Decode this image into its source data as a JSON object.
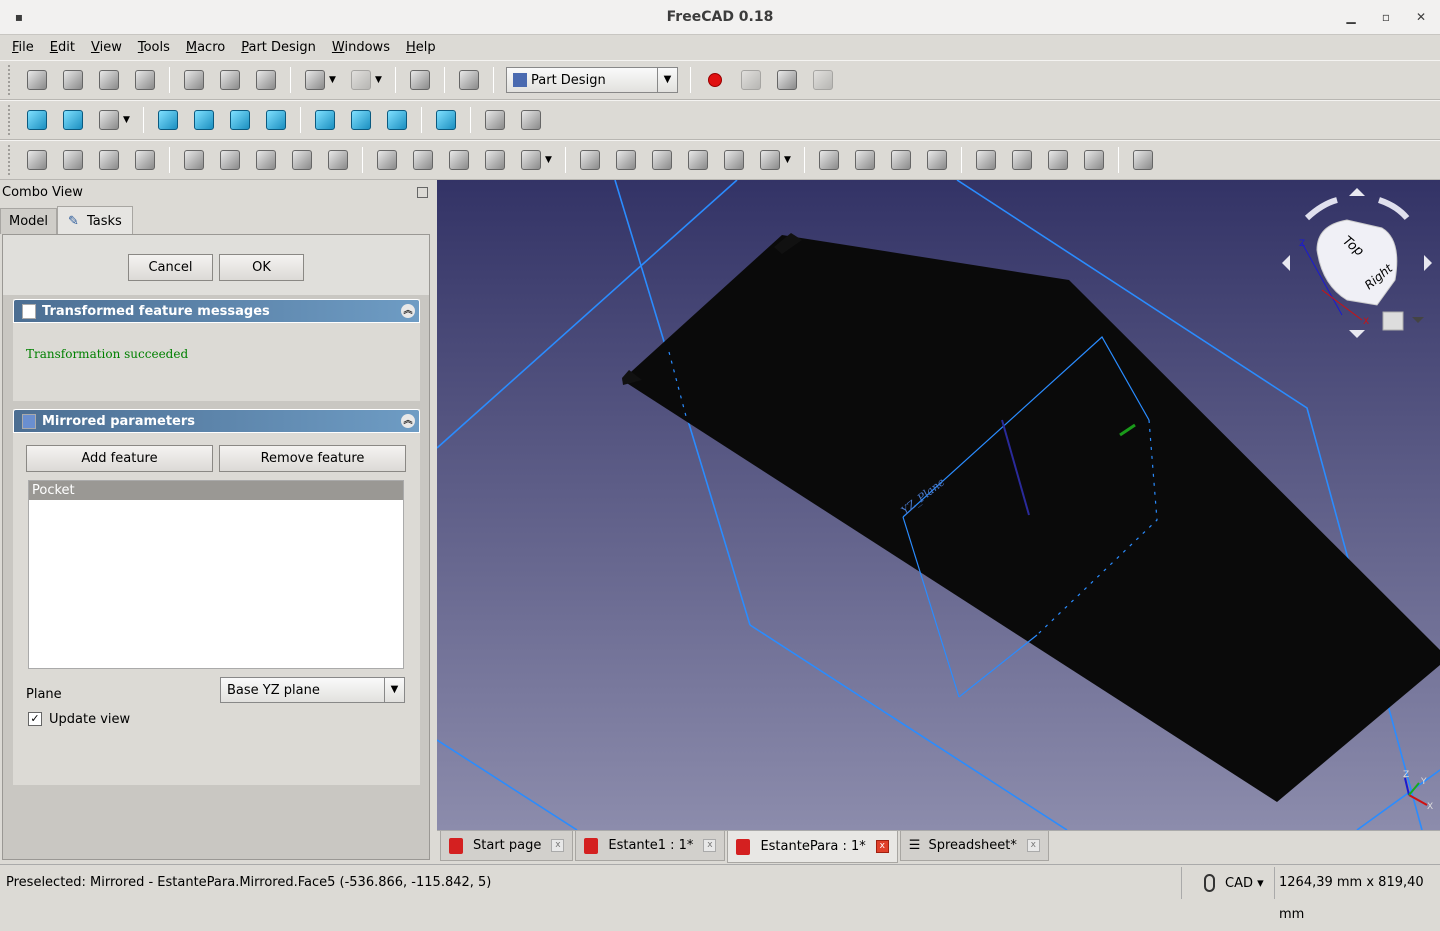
{
  "window": {
    "title": "FreeCAD 0.18",
    "min": "▁",
    "max": "▫",
    "close": "✕",
    "app_icon": "▪"
  },
  "menu": [
    "File",
    "Edit",
    "View",
    "Tools",
    "Macro",
    "Part Design",
    "Windows",
    "Help"
  ],
  "toolbar1": {
    "icons": [
      "new-file",
      "open-file",
      "import",
      "print",
      "|",
      "cut",
      "copy",
      "paste",
      "|",
      "undo",
      "undo-dropdown",
      "redo",
      "redo-dropdown",
      "|",
      "refresh",
      "|",
      "whats-this",
      "|",
      "WB",
      "|",
      "record-macro",
      "stop-macro",
      "edit-macro",
      "run-macro"
    ],
    "workbench": "Part Design"
  },
  "toolbar2": {
    "icons": [
      "fit-all",
      "fit-selection",
      "draw-style",
      "draw-style-dropdown",
      "|",
      "isometric-view",
      "front-view",
      "top-view",
      "right-view",
      "|",
      "rear-view",
      "bottom-view",
      "left-view",
      "|",
      "measure-distance",
      "|",
      "part-icon",
      "group-icon"
    ]
  },
  "toolbar3": {
    "icons": [
      "create-body",
      "create-part",
      "shape-binder",
      "clone",
      "|",
      "datum-point",
      "datum-line",
      "datum-plane",
      "datum-shape",
      "sketch",
      "|",
      "pad",
      "revolution",
      "additive-loft",
      "additive-pipe",
      "additive-primitive",
      "additive-dropdown",
      "|",
      "pocket",
      "hole",
      "groove",
      "subtractive-loft",
      "subtractive-pipe",
      "subtractive-primitive",
      "subtractive-dropdown",
      "|",
      "mirrored",
      "linear-pattern",
      "polar-pattern",
      "multi-transform",
      "|",
      "fillet",
      "chamfer",
      "draft",
      "thickness",
      "|",
      "boolean"
    ]
  },
  "combo": {
    "title": "Combo View",
    "tabs": [
      "Model",
      "Tasks"
    ]
  },
  "task": {
    "cancel": "Cancel",
    "ok": "OK",
    "messages": {
      "title": "Transformed feature messages",
      "text": "Transformation succeeded",
      "text_color": "#008000"
    },
    "mirrored": {
      "title": "Mirrored parameters",
      "add": "Add feature",
      "remove": "Remove feature",
      "features": [
        "Pocket"
      ],
      "plane_label": "Plane",
      "plane_value": "Base YZ plane",
      "update_label": "Update view",
      "update_checked": true
    }
  },
  "viewport": {
    "plane_label": "YZ_Plane",
    "navcube": {
      "top": "Top",
      "right": "Right",
      "axis_z": "Z",
      "axis_x": "X",
      "axis_y": "Y"
    }
  },
  "doc_tabs": [
    {
      "label": "Start page",
      "active": false
    },
    {
      "label": "Estante1 : 1*",
      "active": false
    },
    {
      "label": "EstantePara : 1*",
      "active": true
    },
    {
      "label": "Spreadsheet*",
      "active": false
    }
  ],
  "status": {
    "message": "Preselected: Mirrored - EstantePara.Mirrored.Face5 (-536.866, -115.842, 5)",
    "nav_style": "CAD ▾",
    "dimensions": "1264,39 mm x 819,40 mm"
  }
}
